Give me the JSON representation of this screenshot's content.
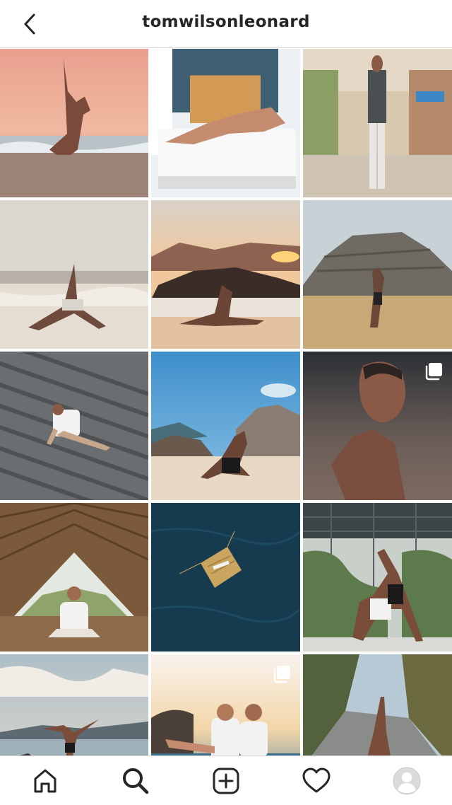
{
  "header": {
    "username": "tomwilsonleonard",
    "back_icon": "chevron-left-icon"
  },
  "grid": {
    "posts": [
      {
        "scene": "yoga pose on beach at sunset",
        "multi": false
      },
      {
        "scene": "yoga stretch on mattress",
        "multi": false
      },
      {
        "scene": "man walking on street",
        "multi": false
      },
      {
        "scene": "triangle pose on misty beach",
        "multi": false
      },
      {
        "scene": "lunge on rocky beach at sunset",
        "multi": false
      },
      {
        "scene": "standing pose by pyramid",
        "multi": false
      },
      {
        "scene": "stretch on stone steps",
        "multi": false
      },
      {
        "scene": "king pigeon pose by rocks",
        "multi": false
      },
      {
        "scene": "portrait profile at dusk",
        "multi": true
      },
      {
        "scene": "meditation in bamboo pavilion",
        "multi": false
      },
      {
        "scene": "raft on deep blue water",
        "multi": false
      },
      {
        "scene": "wheel pose in glasshouse",
        "multi": false
      },
      {
        "scene": "standing pose on rocky coast",
        "multi": false
      },
      {
        "scene": "couple on beach at sunset",
        "multi": true
      },
      {
        "scene": "backbend on road",
        "multi": false
      }
    ]
  },
  "bottom_nav": {
    "items": [
      "home-icon",
      "search-icon",
      "new-post-icon",
      "activity-heart-icon",
      "profile-avatar-icon"
    ]
  },
  "colors": {
    "text": "#262626",
    "border": "#dbdbdb",
    "multi_icon": "#ffffff"
  }
}
